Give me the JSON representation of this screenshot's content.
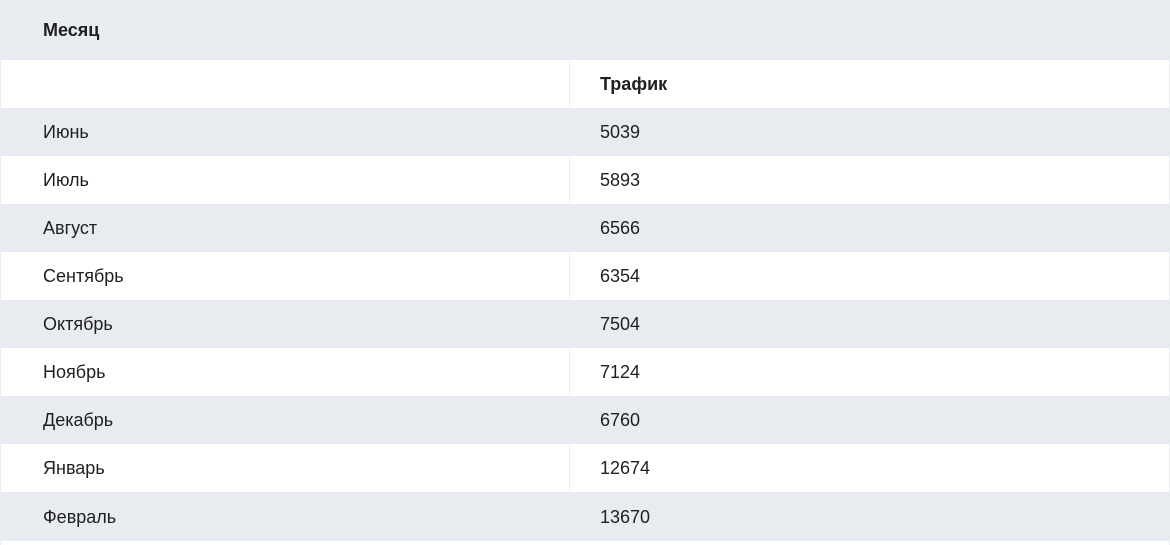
{
  "table": {
    "month_header": "Месяц",
    "traffic_header": "Трафик",
    "rows": [
      {
        "month": "Июнь",
        "traffic": "5039"
      },
      {
        "month": "Июль",
        "traffic": "5893"
      },
      {
        "month": "Август",
        "traffic": "6566"
      },
      {
        "month": "Сентябрь",
        "traffic": "6354"
      },
      {
        "month": "Октябрь",
        "traffic": "7504"
      },
      {
        "month": "Ноябрь",
        "traffic": "7124"
      },
      {
        "month": "Декабрь",
        "traffic": "6760"
      },
      {
        "month": "Январь",
        "traffic": "12674"
      },
      {
        "month": "Февраль",
        "traffic": "13670"
      }
    ]
  }
}
